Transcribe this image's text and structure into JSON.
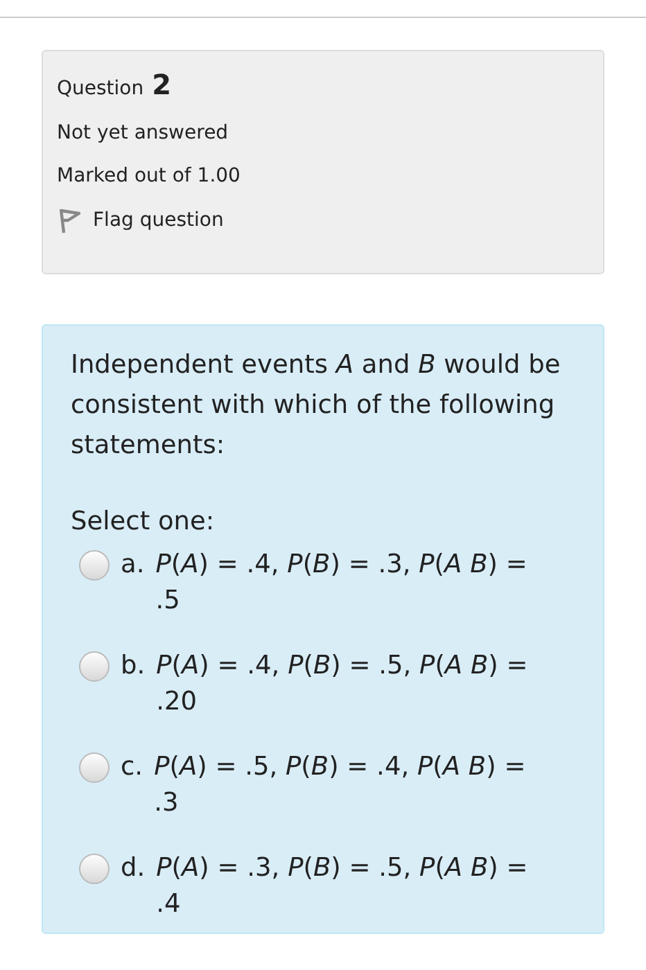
{
  "info": {
    "question_label": "Question",
    "question_number": "2",
    "status": "Not yet answered",
    "marks": "Marked out of 1.00",
    "flag_label": "Flag question"
  },
  "question": {
    "text": "Independent events *A* and *B* would be consistent with which of the following statements:",
    "prompt": "Select one:",
    "options": [
      {
        "letter": "a.",
        "text": "*P*(*A*) = .4, *P*(*B*) = .3, *P*(*A* *B*) = .5",
        "selected": false
      },
      {
        "letter": "b.",
        "text": "*P*(*A*) = .4, *P*(*B*) = .5, *P*(*A* *B*) = .20",
        "selected": false
      },
      {
        "letter": "c.",
        "text": "*P*(*A*) = .5, *P*(*B*) = .4, *P*(*A* *B*) = .3",
        "selected": false
      },
      {
        "letter": "d.",
        "text": "*P*(*A*) = .3, *P*(*B*) = .5, *P*(*A* *B*) = .4",
        "selected": false
      }
    ]
  }
}
